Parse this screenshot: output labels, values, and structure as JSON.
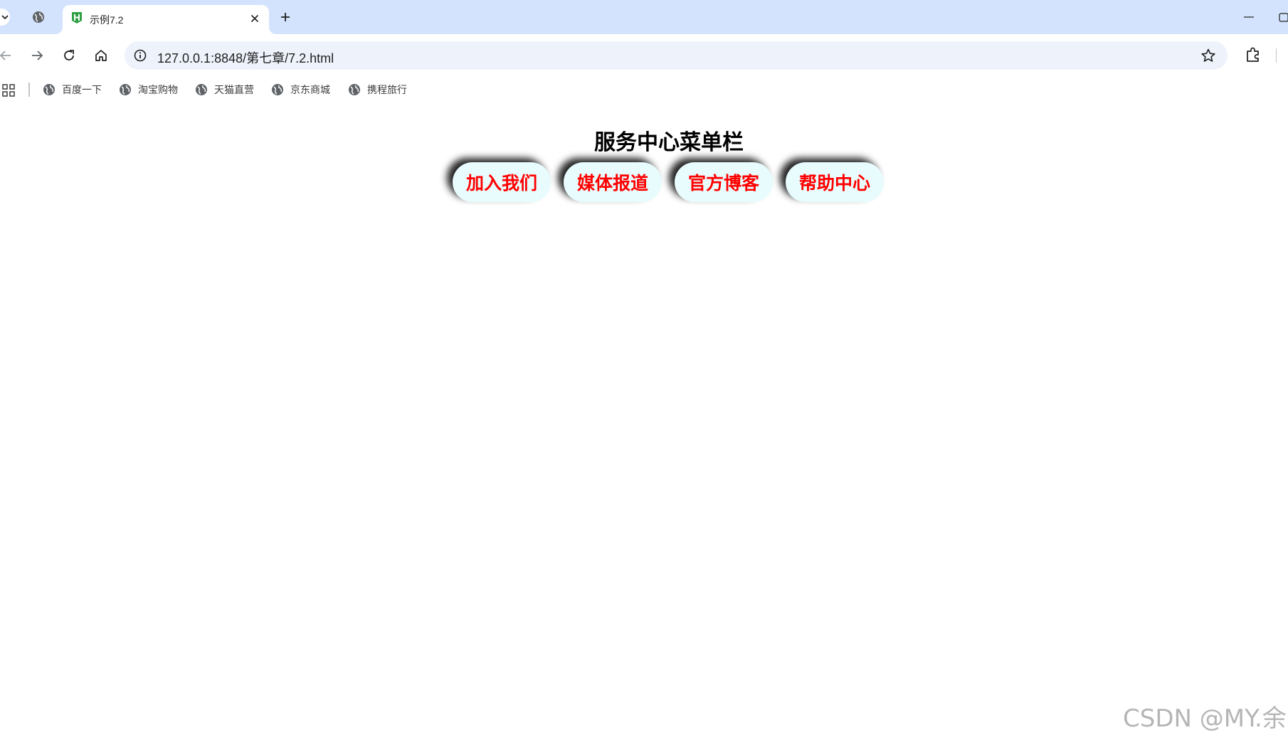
{
  "browser": {
    "tab_title": "示例7.2",
    "url": "127.0.0.1:8848/第七章/7.2.html",
    "bookmarks": [
      {
        "label": "百度一下",
        "icon": "globe-icon"
      },
      {
        "label": "淘宝购物",
        "icon": "globe-icon"
      },
      {
        "label": "天猫直营",
        "icon": "globe-icon"
      },
      {
        "label": "京东商城",
        "icon": "globe-icon"
      },
      {
        "label": "携程旅行",
        "icon": "globe-icon"
      }
    ]
  },
  "page": {
    "heading": "服务中心菜单栏",
    "menu_items": [
      {
        "label": "加入我们"
      },
      {
        "label": "媒体报道"
      },
      {
        "label": "官方博客"
      },
      {
        "label": "帮助中心"
      }
    ],
    "colors": {
      "menu_text": "#ff0000",
      "menu_background": "#e8fcfd",
      "menu_shadow": "#000000",
      "tabstrip": "#d3e3fd",
      "omnibox": "#eef3fb"
    }
  },
  "watermark": "CSDN @MY.余"
}
